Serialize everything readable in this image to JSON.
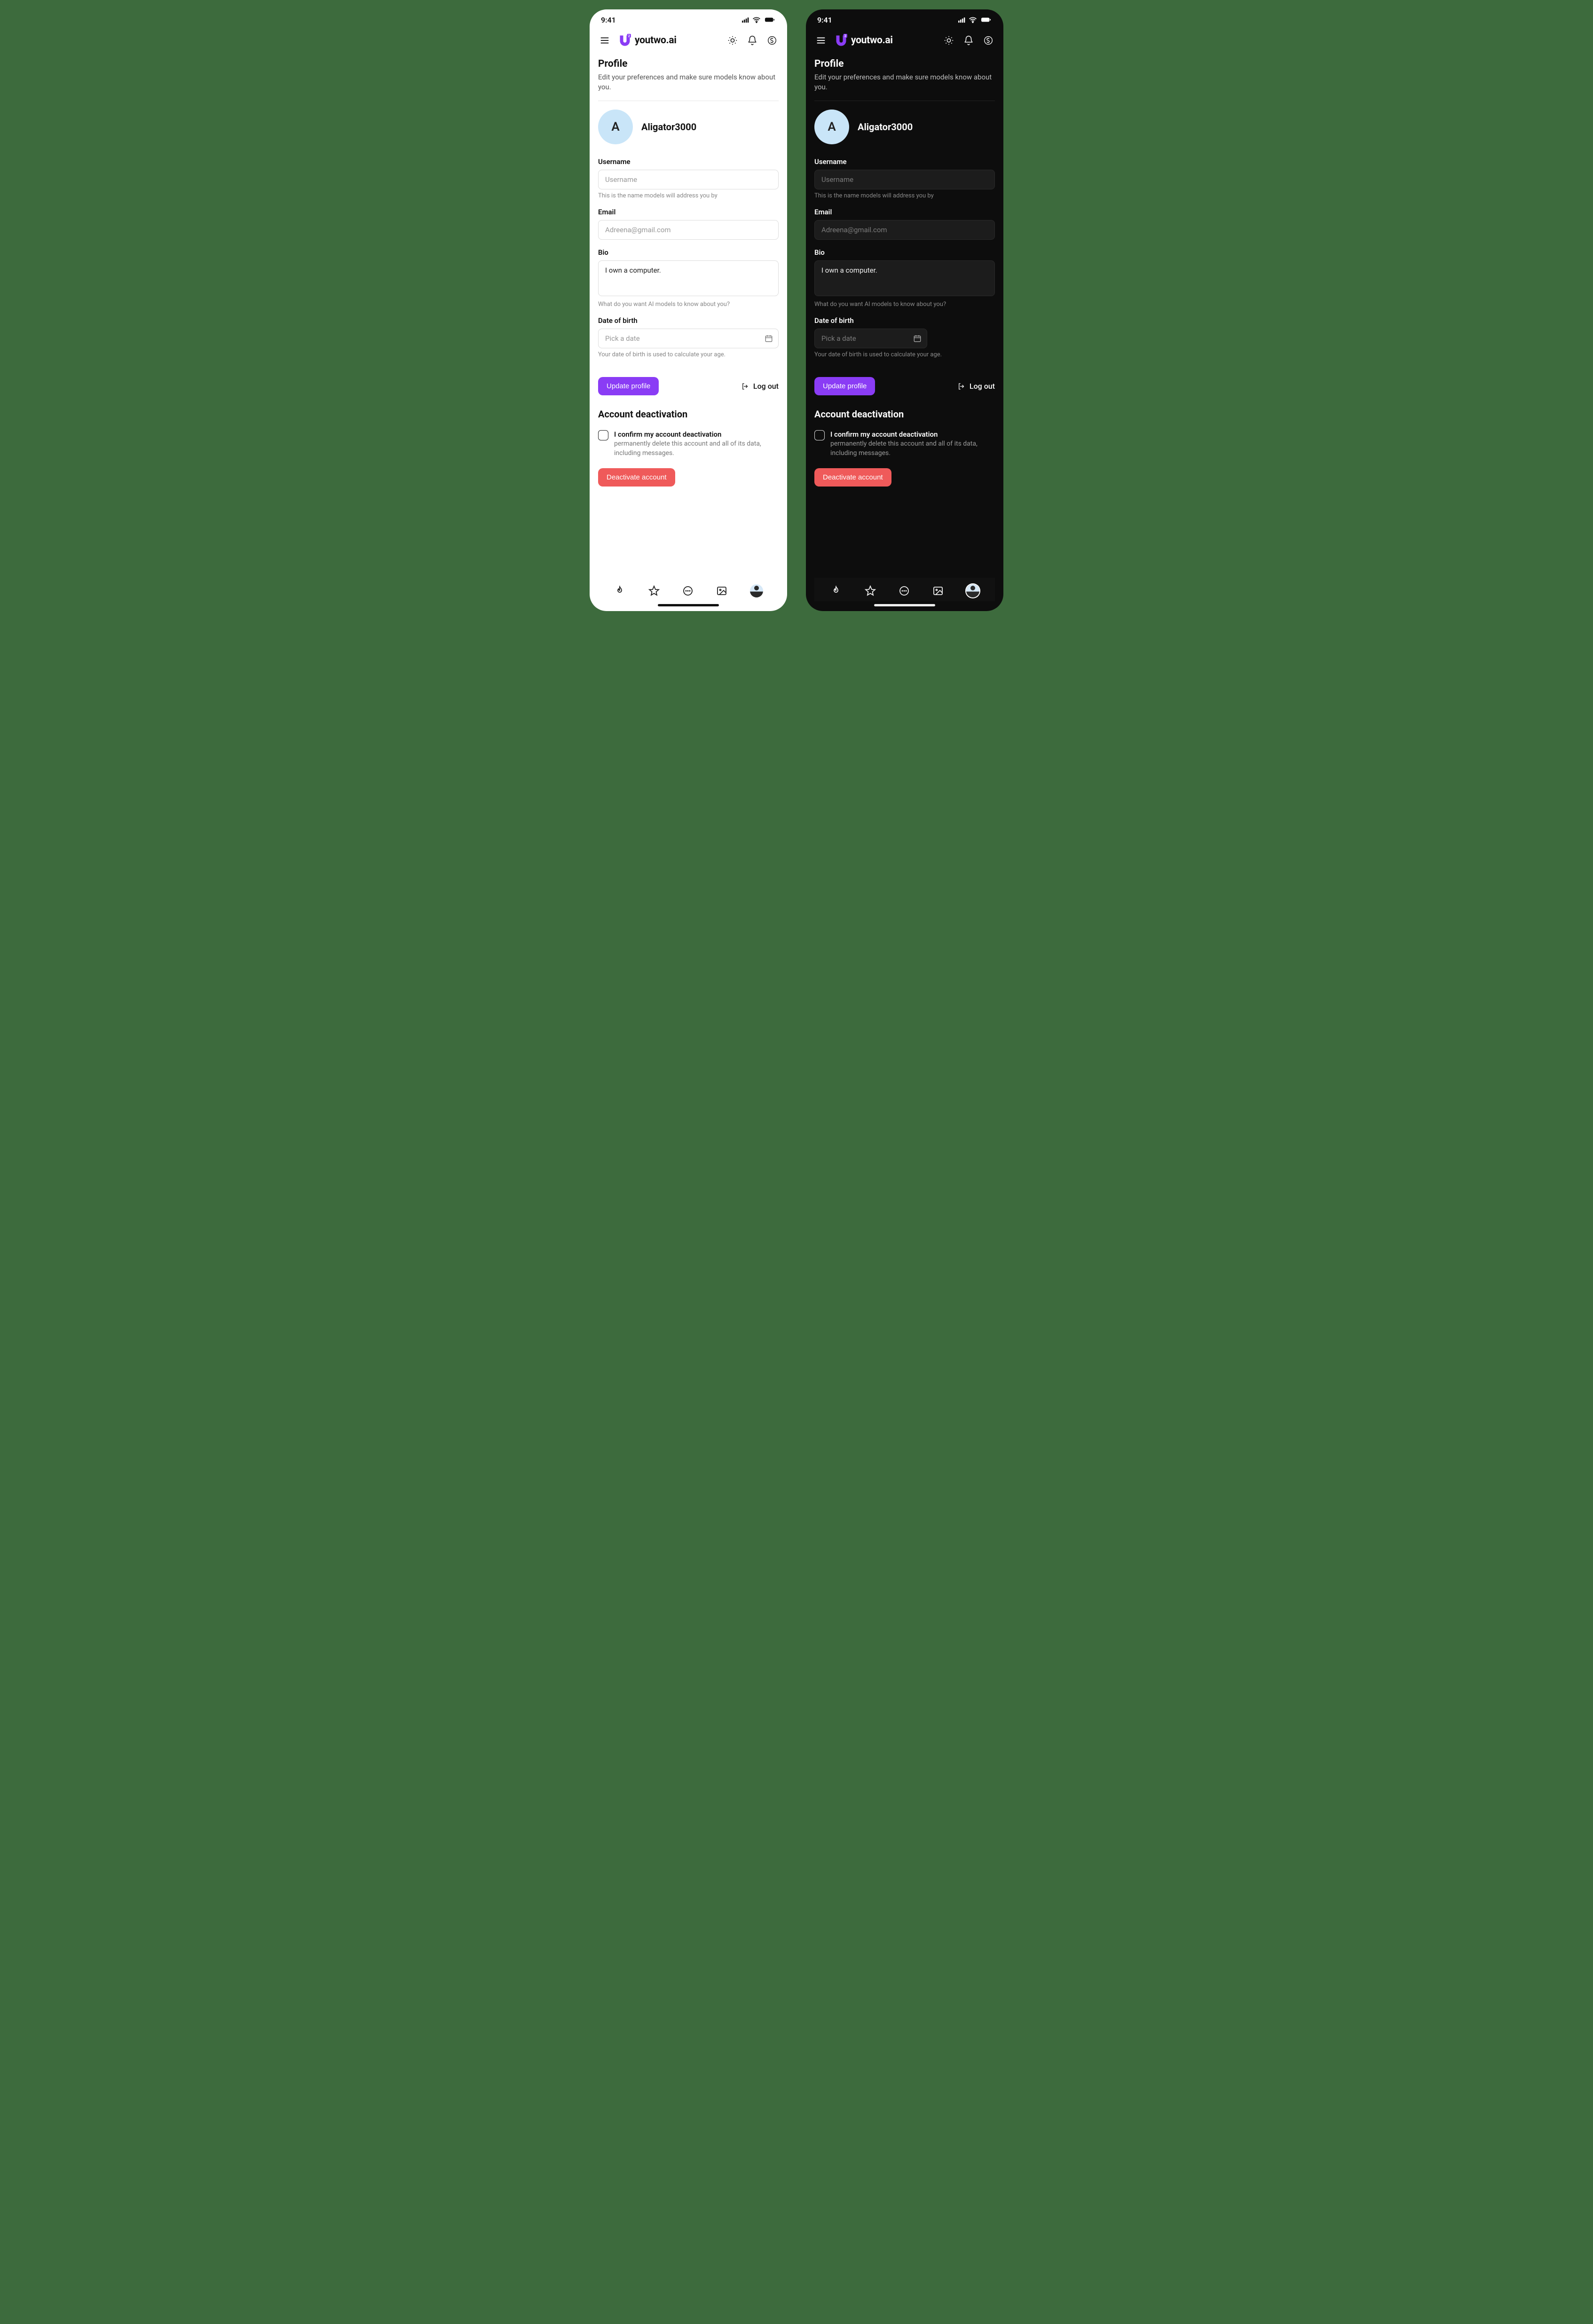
{
  "status": {
    "time": "9:41"
  },
  "brand": {
    "name": "youtwo.ai"
  },
  "page": {
    "title": "Profile",
    "subtitle": "Edit your preferences and make sure models know about you."
  },
  "user": {
    "initial": "A",
    "display_name": "Aligator3000"
  },
  "fields": {
    "username": {
      "label": "Username",
      "placeholder": "Username",
      "value": "",
      "hint": "This is the name models will address you by"
    },
    "email": {
      "label": "Email",
      "placeholder": "Adreena@gmail.com",
      "value": ""
    },
    "bio": {
      "label": "Bio",
      "value": "I own a computer.",
      "hint": "What do you want AI models to know about you?"
    },
    "dob": {
      "label": "Date of birth",
      "placeholder": "Pick a date",
      "value": "",
      "hint": "Your date of birth is used to calculate your age."
    }
  },
  "actions": {
    "update": "Update profile",
    "logout": "Log out"
  },
  "deactivation": {
    "title": "Account deactivation",
    "confirm_label": "I confirm my account deactivation",
    "confirm_desc": "permanently delete this account and all of its data, including messages.",
    "button": "Deactivate account"
  },
  "colors": {
    "accent": "#8a3cf5",
    "danger": "#ef5a5a",
    "avatar_bg": "#c9e5f8"
  }
}
